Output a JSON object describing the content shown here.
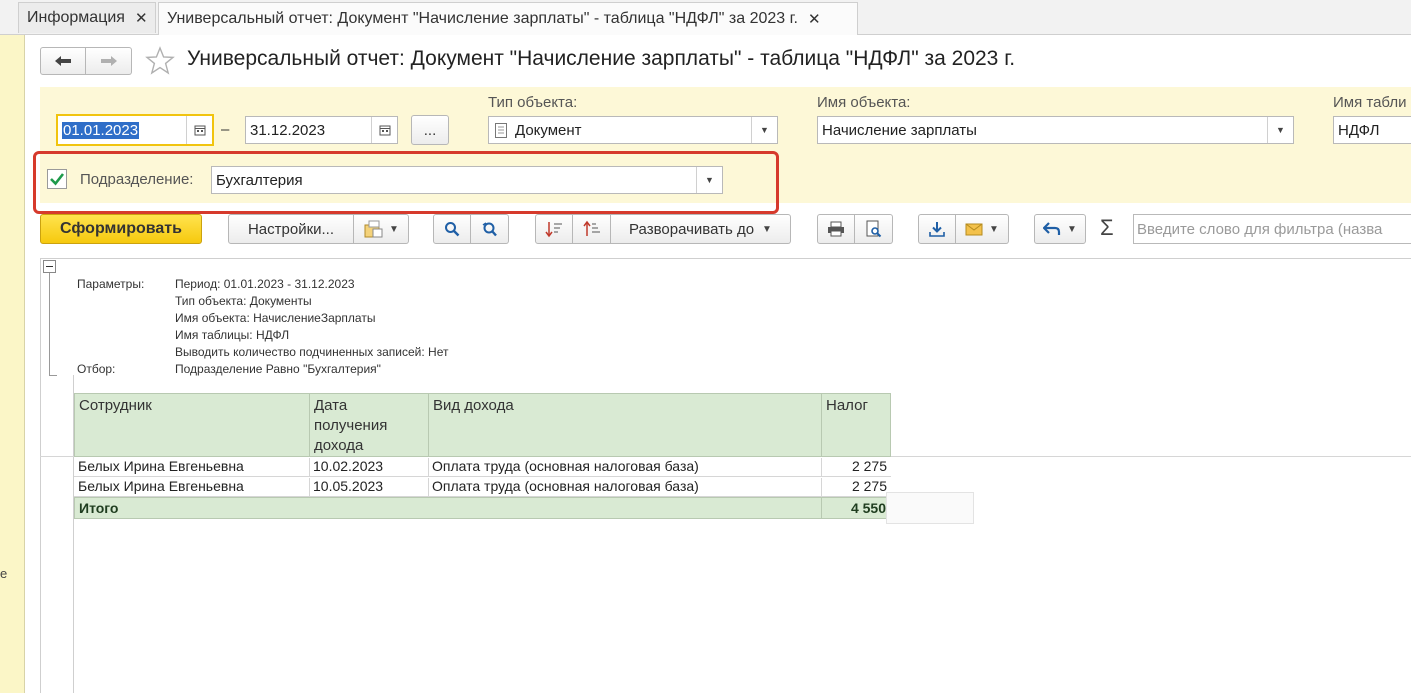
{
  "tabs": [
    {
      "label": "Информация"
    },
    {
      "label": "Универсальный отчет: Документ \"Начисление зарплаты\" - таблица \"НДФЛ\" за 2023 г."
    }
  ],
  "header": {
    "title": "Универсальный отчет: Документ \"Начисление зарплаты\" - таблица \"НДФЛ\" за 2023 г."
  },
  "filters": {
    "date_from": "01.01.2023",
    "date_sep": "–",
    "date_to": "31.12.2023",
    "period_button": "...",
    "object_type_label": "Тип объекта:",
    "object_type_value": "Документ",
    "object_name_label": "Имя объекта:",
    "object_name_value": "Начисление зарплаты",
    "table_name_label": "Имя табли",
    "table_name_value": "НДФЛ",
    "department_label": "Подразделение:",
    "department_value": "Бухгалтерия",
    "department_checked": true
  },
  "toolbar": {
    "generate": "Сформировать",
    "settings": "Настройки...",
    "expand": "Разворачивать до",
    "sum_symbol": "Σ",
    "search_placeholder": "Введите слово для фильтра (назва"
  },
  "report": {
    "params_label": "Параметры:",
    "params": [
      "Период: 01.01.2023 - 31.12.2023",
      "Тип объекта: Документы",
      "Имя объекта: НачислениеЗарплаты",
      "Имя таблицы: НДФЛ",
      "Выводить количество подчиненных записей: Нет"
    ],
    "filter_label": "Отбор:",
    "filter_value": "Подразделение Равно \"Бухгалтерия\"",
    "columns": [
      "Сотрудник",
      "Дата получения дохода",
      "Вид дохода",
      "Налог"
    ],
    "column_lines": {
      "date": [
        "Дата",
        "получения",
        "дохода"
      ]
    },
    "rows": [
      {
        "employee": "Белых Ирина Евгеньевна",
        "date": "10.02.2023",
        "income_type": "Оплата труда (основная налоговая база)",
        "tax": "2 275"
      },
      {
        "employee": "Белых Ирина Евгеньевна",
        "date": "10.05.2023",
        "income_type": "Оплата труда (основная налоговая база)",
        "tax": "2 275"
      }
    ],
    "total_label": "Итого",
    "total_value": "4 550"
  },
  "colors": {
    "accent_yellow": "#f6c90e",
    "panel_bg": "#fdf8d7",
    "table_header_bg": "#d9ead3",
    "highlight_red": "#d63a2c"
  },
  "icons": [
    "back-arrow-icon",
    "forward-arrow-icon",
    "favorite-star-icon",
    "calendar-icon",
    "document-icon",
    "checkbox-checked-icon",
    "variant-settings-icon",
    "search-icon",
    "search-refresh-icon",
    "sort-desc-icon",
    "sort-asc-icon",
    "print-icon",
    "print-preview-icon",
    "download-icon",
    "mail-icon",
    "return-icon",
    "sum-icon",
    "collapse-icon"
  ]
}
